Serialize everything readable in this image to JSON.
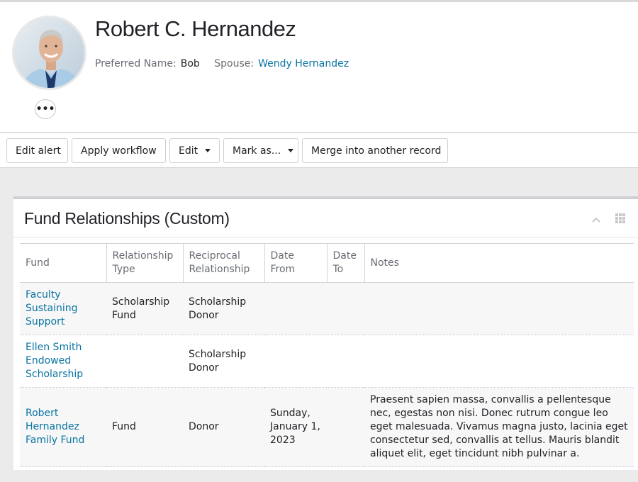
{
  "header": {
    "name": "Robert C. Hernandez",
    "preferred_label": "Preferred Name:",
    "preferred_value": "Bob",
    "spouse_label": "Spouse:",
    "spouse_value": "Wendy Hernandez",
    "more_label": "•••"
  },
  "toolbar": {
    "edit_alert": "Edit alert",
    "apply_workflow": "Apply workflow",
    "edit": "Edit",
    "mark_as": "Mark as...",
    "merge": "Merge into another record"
  },
  "tile": {
    "title": "Fund Relationships (Custom)",
    "icons": [
      "chevron-up-icon",
      "grid-icon"
    ],
    "columns": [
      "Fund",
      "Relationship Type",
      "Reciprocal Relationship",
      "Date From",
      "Date To",
      "Notes"
    ],
    "rows": [
      {
        "fund": "Faculty Sustaining Support",
        "relationship_type": "Scholarship Fund",
        "reciprocal": "Scholarship Donor",
        "date_from": "",
        "date_to": "",
        "notes": ""
      },
      {
        "fund": "Ellen Smith Endowed Scholarship",
        "relationship_type": "",
        "reciprocal": "Scholarship Donor",
        "date_from": "",
        "date_to": "",
        "notes": ""
      },
      {
        "fund": "Robert Hernandez Family Fund",
        "relationship_type": "Fund",
        "reciprocal": "Donor",
        "date_from": "Sunday, January 1, 2023",
        "date_to": "",
        "notes": "Praesent sapien massa, convallis a pellentesque nec, egestas non nisi. Donec rutrum congue leo eget malesuada. Vivamus magna justo, lacinia eget consectetur sed, convallis at tellus. Mauris blandit aliquet elit, eget tincidunt nibh pulvinar a."
      }
    ]
  },
  "colors": {
    "link": "#0974a1",
    "text": "#212327",
    "label": "#686c73",
    "background": "#ebebeb"
  }
}
